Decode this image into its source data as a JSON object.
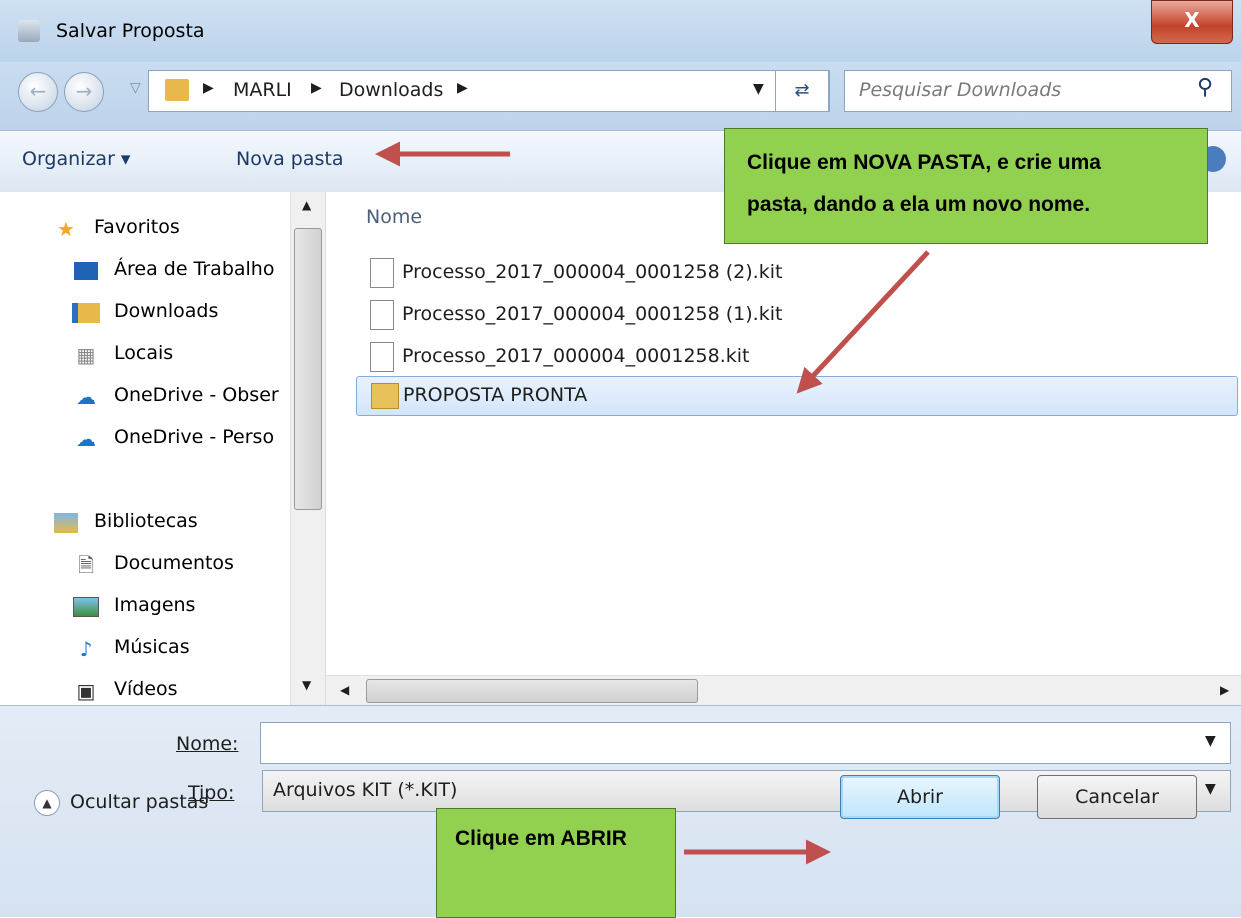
{
  "window": {
    "title": "Salvar Proposta",
    "close_label": "X"
  },
  "address": {
    "path": [
      "MARLI",
      "Downloads"
    ],
    "search_placeholder": "Pesquisar Downloads"
  },
  "toolbar": {
    "organize": "Organizar ▾",
    "new_folder": "Nova pasta"
  },
  "nav": {
    "favorites_header": "Favoritos",
    "favorites": [
      "Área de Trabalho",
      "Downloads",
      "Locais",
      "OneDrive - Obser",
      "OneDrive - Perso"
    ],
    "libraries_header": "Bibliotecas",
    "libraries": [
      "Documentos",
      "Imagens",
      "Músicas",
      "Vídeos"
    ]
  },
  "files": {
    "column_header": "Nome",
    "items": [
      "Processo_2017_000004_0001258 (2).kit",
      "Processo_2017_000004_0001258 (1).kit",
      "Processo_2017_000004_0001258.kit",
      "PROPOSTA PRONTA"
    ]
  },
  "form": {
    "name_label": "Nome:",
    "name_value": "",
    "type_label": "Tipo:",
    "type_value": "Arquivos KIT (*.KIT)",
    "hide_folders": "Ocultar pastas",
    "open_button": "Abrir",
    "cancel_button": "Cancelar"
  },
  "annotations": {
    "callout_top_line1": "Clique em NOVA PASTA, e crie uma",
    "callout_top_line2": "pasta, dando a ela um novo nome.",
    "callout_bottom": "Clique em ABRIR"
  },
  "colors": {
    "callout": "#92d050",
    "arrow": "#c0504d",
    "selection": "#d3e5fb"
  }
}
